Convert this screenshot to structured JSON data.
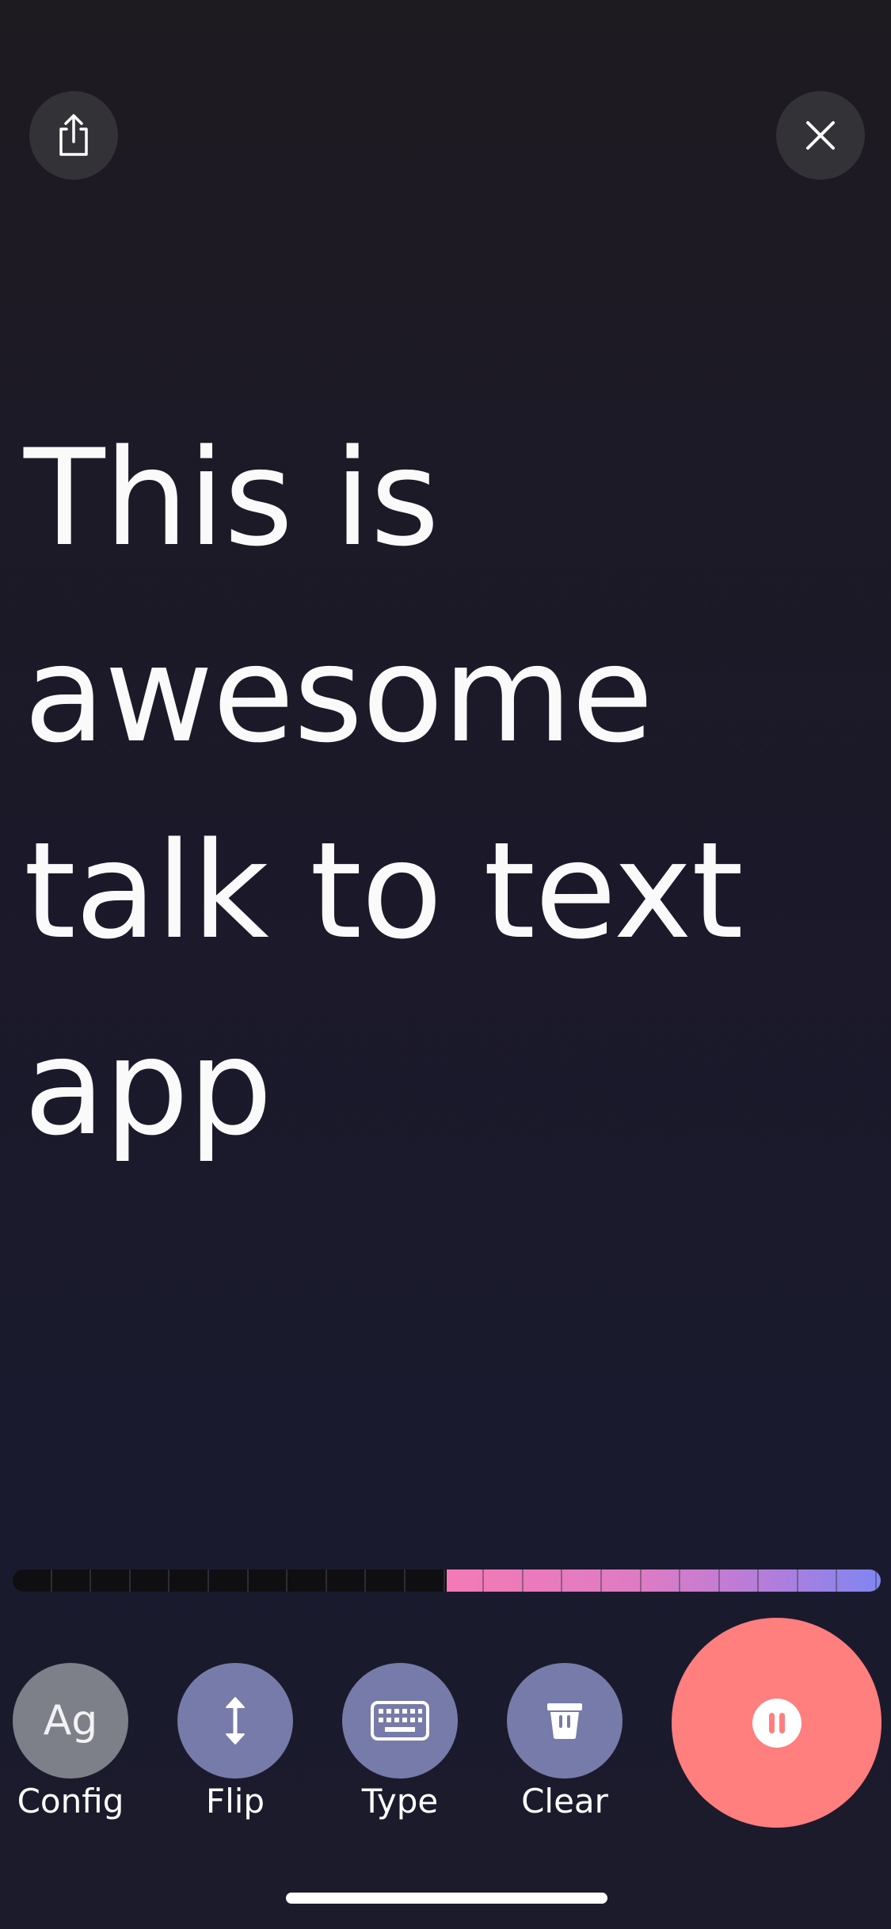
{
  "header": {
    "share_icon": "share-icon",
    "close_icon": "close-icon"
  },
  "transcript": {
    "lines": [
      "This is",
      "awesome",
      "talk to text",
      "app"
    ]
  },
  "audio_level": {
    "level": 0.5,
    "colors": [
      "#f47ab6",
      "#b27ddc",
      "#7f86f3"
    ]
  },
  "toolbar": {
    "config": {
      "icon_text": "Ag",
      "label": "Config"
    },
    "flip": {
      "icon": "vertical-arrows-icon",
      "label": "Flip"
    },
    "type": {
      "icon": "keyboard-icon",
      "label": "Type"
    },
    "clear": {
      "icon": "trash-icon",
      "label": "Clear"
    },
    "record": {
      "icon": "pause-icon",
      "state": "recording",
      "color": "#ff7e7e"
    }
  },
  "colors": {
    "background": "#1b1929",
    "button_purple": "#777ba9",
    "button_gray": "#7d8089",
    "record_red": "#ff7e7e"
  }
}
